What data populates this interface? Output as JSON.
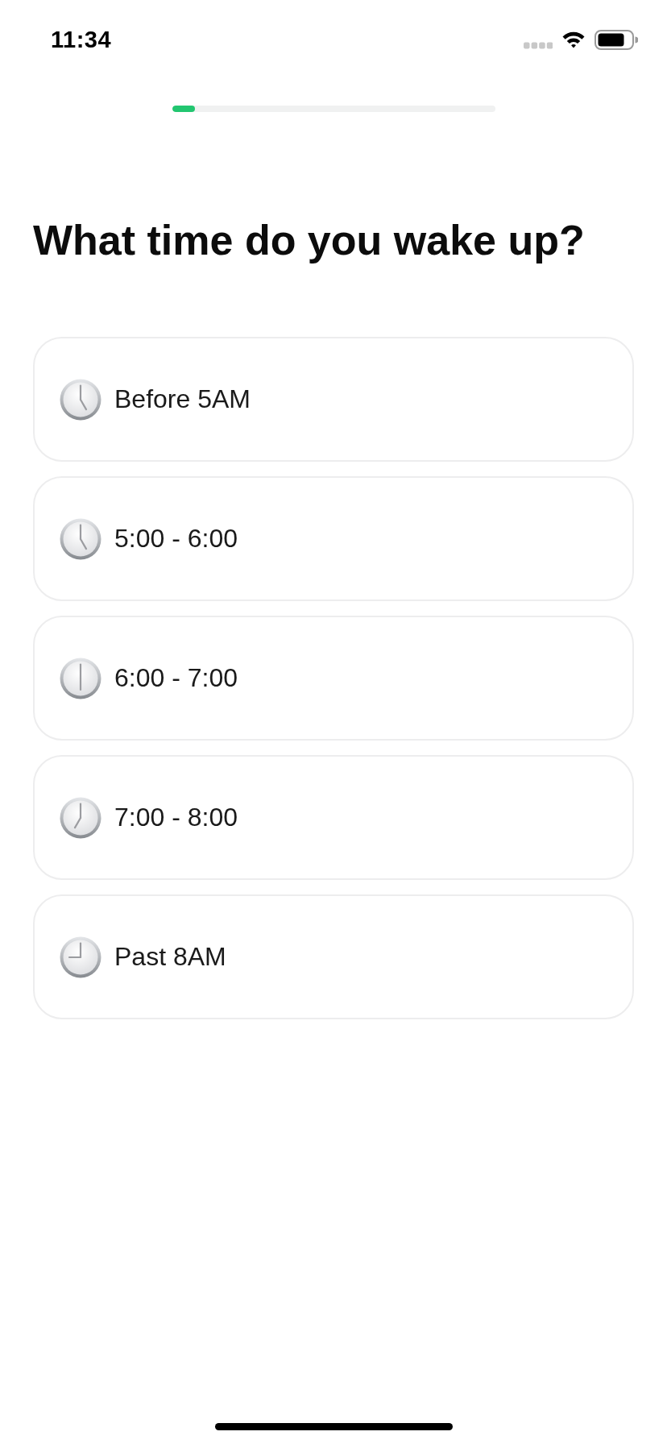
{
  "status_bar": {
    "time": "11:34"
  },
  "progress": {
    "level": 0.07
  },
  "title": "What time do you wake up?",
  "options": [
    {
      "kind": "five",
      "label": "Before 5AM",
      "selected": false
    },
    {
      "kind": "five",
      "label": "5:00 - 6:00",
      "selected": false
    },
    {
      "kind": "six",
      "label": "6:00 - 7:00",
      "selected": false
    },
    {
      "kind": "seven",
      "label": "7:00 - 8:00",
      "selected": false
    },
    {
      "kind": "nine",
      "label": "Past 8AM",
      "selected": false
    }
  ]
}
